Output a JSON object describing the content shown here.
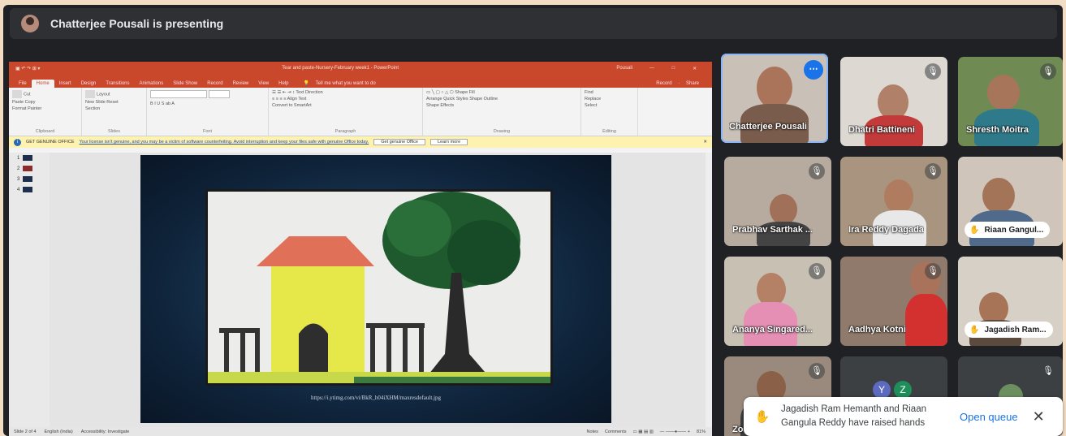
{
  "presenting_banner": {
    "text": "Chatterjee Pousali is presenting"
  },
  "powerpoint": {
    "window_title": "Tear and paste-Nursery-February week1 - PowerPoint",
    "user": "Pousali",
    "window_controls": [
      "—",
      "□",
      "✕"
    ],
    "tabs": [
      "File",
      "Home",
      "Insert",
      "Design",
      "Transitions",
      "Animations",
      "Slide Show",
      "Record",
      "Review",
      "View",
      "Help"
    ],
    "active_tab": "Home",
    "tell_me": "Tell me what you want to do",
    "record_label": "Record",
    "share_label": "Share",
    "ribbon_groups": {
      "clipboard": {
        "label": "Clipboard",
        "paste": "Paste",
        "cut": "Cut",
        "copy": "Copy",
        "format_painter": "Format Painter"
      },
      "slides": {
        "label": "Slides",
        "new_slide": "New Slide",
        "layout": "Layout",
        "reset": "Reset",
        "section": "Section"
      },
      "font": {
        "label": "Font"
      },
      "paragraph": {
        "label": "Paragraph",
        "text_direction": "Text Direction",
        "align_text": "Align Text",
        "smartart": "Convert to SmartArt"
      },
      "drawing": {
        "label": "Drawing",
        "arrange": "Arrange",
        "quick_styles": "Quick Styles",
        "shape_fill": "Shape Fill",
        "shape_outline": "Shape Outline",
        "shape_effects": "Shape Effects"
      },
      "editing": {
        "label": "Editing",
        "find": "Find",
        "replace": "Replace",
        "select": "Select"
      }
    },
    "warning_bar": {
      "label": "GET GENUINE OFFICE",
      "message": "Your license isn't genuine, and you may be a victim of software counterfeiting. Avoid interruption and keep your files safe with genuine Office today.",
      "button_get": "Get genuine Office",
      "button_learn": "Learn more"
    },
    "slide_numbers": [
      "1",
      "2",
      "3",
      "4"
    ],
    "selected_slide": 2,
    "slide_caption": "https://i.ytimg.com/vi/BkR_h04iXHM/maxresdefault.jpg",
    "status_bar": {
      "slide_of": "Slide 2 of 4",
      "language": "English (India)",
      "accessibility": "Accessibility: Investigate",
      "notes": "Notes",
      "comments": "Comments",
      "zoom": "81%"
    }
  },
  "participants": [
    {
      "name": "Chatterjee Pousali",
      "speaking": true,
      "muted": false,
      "hand_raised": false,
      "bg": "#c7c1bb"
    },
    {
      "name": "Dhatri Battineni",
      "speaking": false,
      "muted": true,
      "hand_raised": false,
      "bg": "#ddd8d2"
    },
    {
      "name": "Shresth Moitra",
      "speaking": false,
      "muted": true,
      "hand_raised": false,
      "bg": "#6f8a52"
    },
    {
      "name": "Prabhav Sarthak ...",
      "speaking": false,
      "muted": true,
      "hand_raised": false,
      "bg": "#b7aa9e"
    },
    {
      "name": "Ira Reddy Dagada",
      "speaking": false,
      "muted": true,
      "hand_raised": false,
      "bg": "#a8947f"
    },
    {
      "name": "Riaan Gangul...",
      "speaking": false,
      "muted": false,
      "hand_raised": true,
      "bg": "#cfc5ba"
    },
    {
      "name": "Ananya Singared...",
      "speaking": false,
      "muted": true,
      "hand_raised": false,
      "bg": "#c9c0b4"
    },
    {
      "name": "Aadhya Kotni",
      "speaking": false,
      "muted": true,
      "hand_raised": false,
      "bg": "#8f7a6c"
    },
    {
      "name": "Jagadish Ram...",
      "speaking": false,
      "muted": false,
      "hand_raised": true,
      "bg": "#d7d0c6"
    },
    {
      "name": "Zo",
      "speaking": false,
      "muted": true,
      "hand_raised": false,
      "bg": "#9a8a7d"
    },
    {
      "name": "",
      "speaking": false,
      "muted": false,
      "hand_raised": false,
      "bg": "#3c4043",
      "initials": [
        "Y",
        "Z"
      ]
    },
    {
      "name": "",
      "speaking": false,
      "muted": true,
      "hand_raised": false,
      "bg": "#3c4043"
    }
  ],
  "toast": {
    "text": "Jagadish Ram Hemanth and Riaan Gangula Reddy have raised hands",
    "action": "Open queue",
    "close": "✕"
  },
  "icons": {
    "mic_off": "mic-off-icon",
    "more": "more-options-icon",
    "hand": "raised-hand-icon",
    "close": "close-icon"
  },
  "colors": {
    "accent_blue": "#1a73e8",
    "speaking_outline": "#8ab4f8",
    "ppt_orange": "#c9472b",
    "meet_bg": "#202124"
  }
}
